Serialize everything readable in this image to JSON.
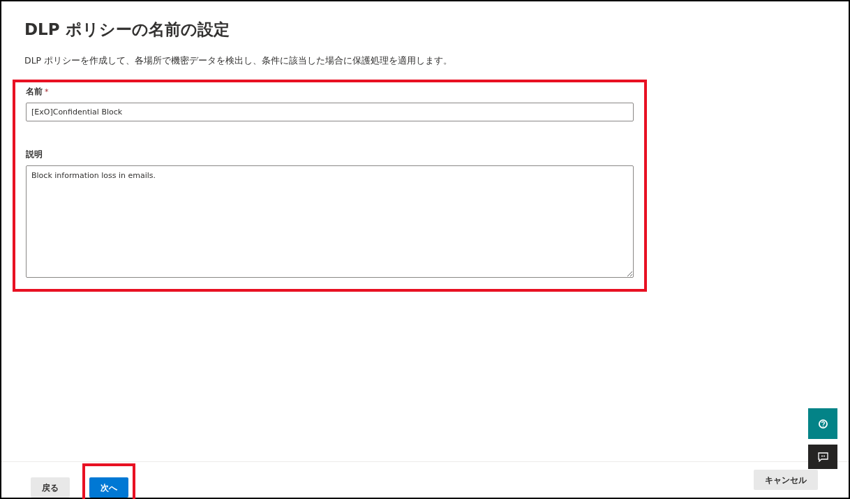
{
  "title": "DLP ポリシーの名前の設定",
  "description": "DLP ポリシーを作成して、各場所で機密データを検出し、条件に該当した場合に保護処理を適用します。",
  "form": {
    "highlighted": true,
    "fields": [
      {
        "kind": "input",
        "label": "名前",
        "required_mark": "*",
        "value": "[ExO]Confidential Block"
      },
      {
        "kind": "textarea",
        "label": "説明",
        "value": "Block information loss in emails."
      }
    ]
  },
  "footer": {
    "buttons": [
      {
        "label": "戻る",
        "kind": "secondary",
        "highlighted": false
      },
      {
        "label": "次へ",
        "kind": "primary",
        "highlighted": true
      }
    ],
    "cancel": {
      "label": "キャンセル"
    }
  },
  "side_buttons": [
    {
      "kind": "help"
    },
    {
      "kind": "feedback"
    }
  ]
}
